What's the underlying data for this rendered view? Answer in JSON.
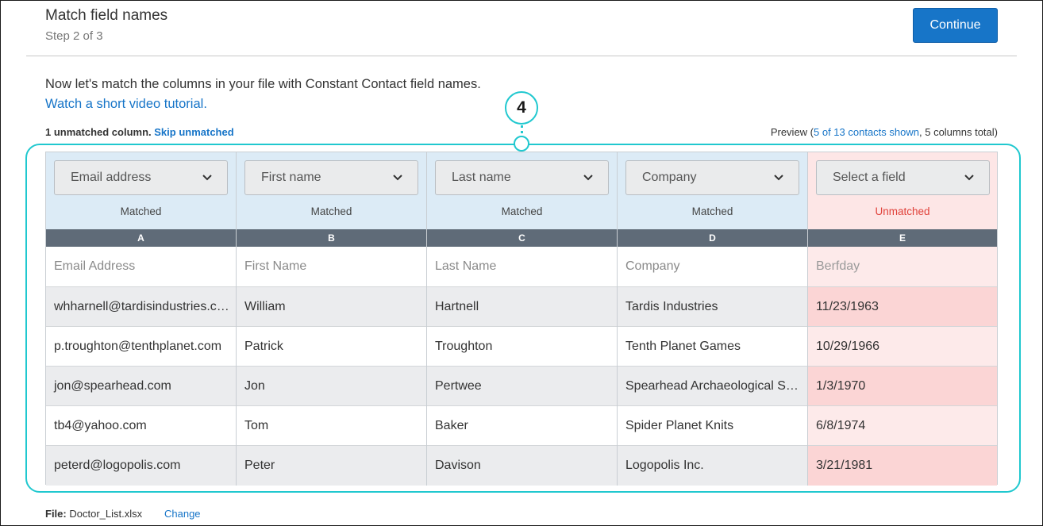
{
  "header": {
    "title": "Match field names",
    "step": "Step 2 of 3",
    "continue_label": "Continue"
  },
  "intro": {
    "text": "Now let's match the columns in your file with Constant Contact field names.",
    "video_link": "Watch a short video tutorial."
  },
  "summary": {
    "unmatched_text": "1 unmatched column.",
    "skip_link": "Skip unmatched",
    "preview_prefix": "Preview (",
    "preview_link": "5 of 13 contacts shown",
    "preview_suffix": ", 5 columns total)"
  },
  "callout": {
    "number": "4",
    "color": "#20c8cf"
  },
  "columns": [
    {
      "field": "Email address",
      "status": "Matched",
      "letter": "A",
      "header": "Email Address",
      "rows": [
        "whharnell@tardisindustries.com",
        "p.troughton@tenthplanet.com",
        "jon@spearhead.com",
        "tb4@yahoo.com",
        "peterd@logopolis.com"
      ]
    },
    {
      "field": "First name",
      "status": "Matched",
      "letter": "B",
      "header": "First Name",
      "rows": [
        "William",
        "Patrick",
        "Jon",
        "Tom",
        "Peter"
      ]
    },
    {
      "field": "Last name",
      "status": "Matched",
      "letter": "C",
      "header": "Last Name",
      "rows": [
        "Hartnell",
        "Troughton",
        "Pertwee",
        "Baker",
        "Davison"
      ]
    },
    {
      "field": "Company",
      "status": "Matched",
      "letter": "D",
      "header": "Company",
      "rows": [
        "Tardis Industries",
        "Tenth Planet Games",
        "Spearhead Archaeological Society",
        "Spider Planet Knits",
        "Logopolis Inc."
      ]
    },
    {
      "field": "Select a field",
      "status": "Unmatched",
      "letter": "E",
      "header": "Berfday",
      "rows": [
        "11/23/1963",
        "10/29/1966",
        "1/3/1970",
        "6/8/1974",
        "3/21/1981"
      ]
    }
  ],
  "footer": {
    "file_label": "File:",
    "file_name": "Doctor_List.xlsx",
    "change_link": "Change"
  },
  "colors": {
    "accent": "#1775c8",
    "matched_bg": "#dcebf6",
    "unmatched_bg": "#fde6e6",
    "unmatched_text": "#e0413a",
    "letter_bar": "#5f6b78"
  }
}
